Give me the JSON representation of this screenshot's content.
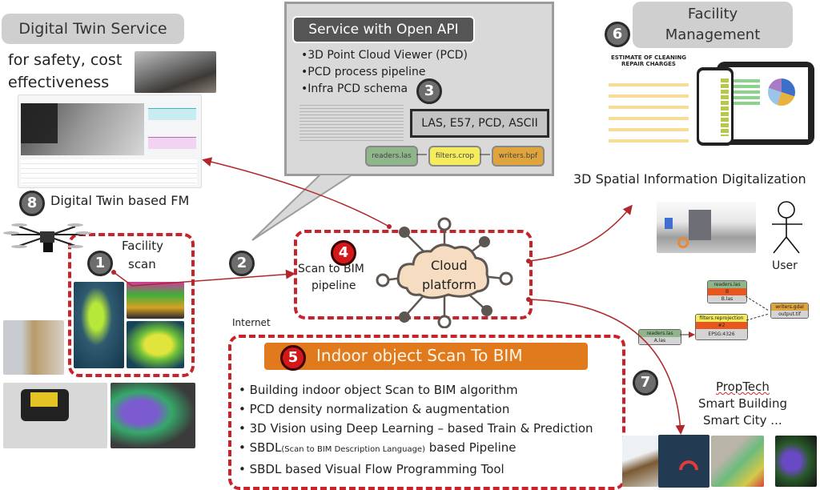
{
  "digital_twin": {
    "title": "Digital Twin Service",
    "subtitle_line1": "for safety, cost",
    "subtitle_line2": "effectiveness",
    "badge": "8",
    "caption": "Digital Twin based FM"
  },
  "open_api": {
    "title": "Service with Open API",
    "bullets": [
      "•3D Point Cloud Viewer (PCD)",
      "•PCD process pipeline",
      "•Infra PCD schema"
    ],
    "badge": "3",
    "formats": "LAS, E57, PCD, ASCII",
    "pipeline": [
      "readers.las",
      "filters.crop",
      "writers.bpf"
    ],
    "colors": {
      "reader": "#8fb58a",
      "filter": "#f4ec5c",
      "writer": "#e0a43c"
    }
  },
  "facility_mgmt": {
    "title_line1": "Facility",
    "title_line2": "Management",
    "badge": "6",
    "doc_title_line1": "ESTIMATE OF CLEANING",
    "doc_title_line2": "REPAIR CHARGES",
    "caption": "3D Spatial Information Digitalization"
  },
  "user": {
    "label": "User"
  },
  "facility_scan": {
    "badge": "1",
    "title_line1": "Facility",
    "title_line2": "scan"
  },
  "step2": {
    "badge": "2"
  },
  "cloud": {
    "badge": "4",
    "pipeline_line1": "Scan to BIM",
    "pipeline_line2": "pipeline",
    "cloud_line1": "Cloud",
    "cloud_line2": "platform",
    "network_label": "Internet"
  },
  "indoor": {
    "badge": "5",
    "title": "Indoor object Scan To BIM",
    "bullets": [
      "Building indoor object Scan to BIM algorithm",
      "PCD density normalization & augmentation",
      "3D Vision using Deep Learning – based Train & Prediction",
      "based Pipeline",
      "SBDL based Visual Flow Programming Tool"
    ],
    "sbdl_prefix": "SBDL",
    "sbdl_small": "(Scan to BIM Description Language)",
    "accent": "#e07a1c"
  },
  "flow": {
    "nodes": [
      {
        "name": "readers.las",
        "mid": "",
        "foot": "A.las"
      },
      {
        "name": "readers.las",
        "mid": "B",
        "foot": "B.las"
      },
      {
        "name": "filters.reprojection",
        "mid": "#2",
        "foot": "EPSG:4326"
      },
      {
        "name": "writers.gdal",
        "mid": "",
        "foot": "output.tif"
      }
    ]
  },
  "applications": {
    "badge": "7",
    "line1": "PropTech",
    "line2": "Smart Building",
    "line3": "Smart City ..."
  },
  "colors": {
    "dash": "#c8232a",
    "arrow": "#b0282c",
    "grey_pill": "#cfcfcf"
  }
}
